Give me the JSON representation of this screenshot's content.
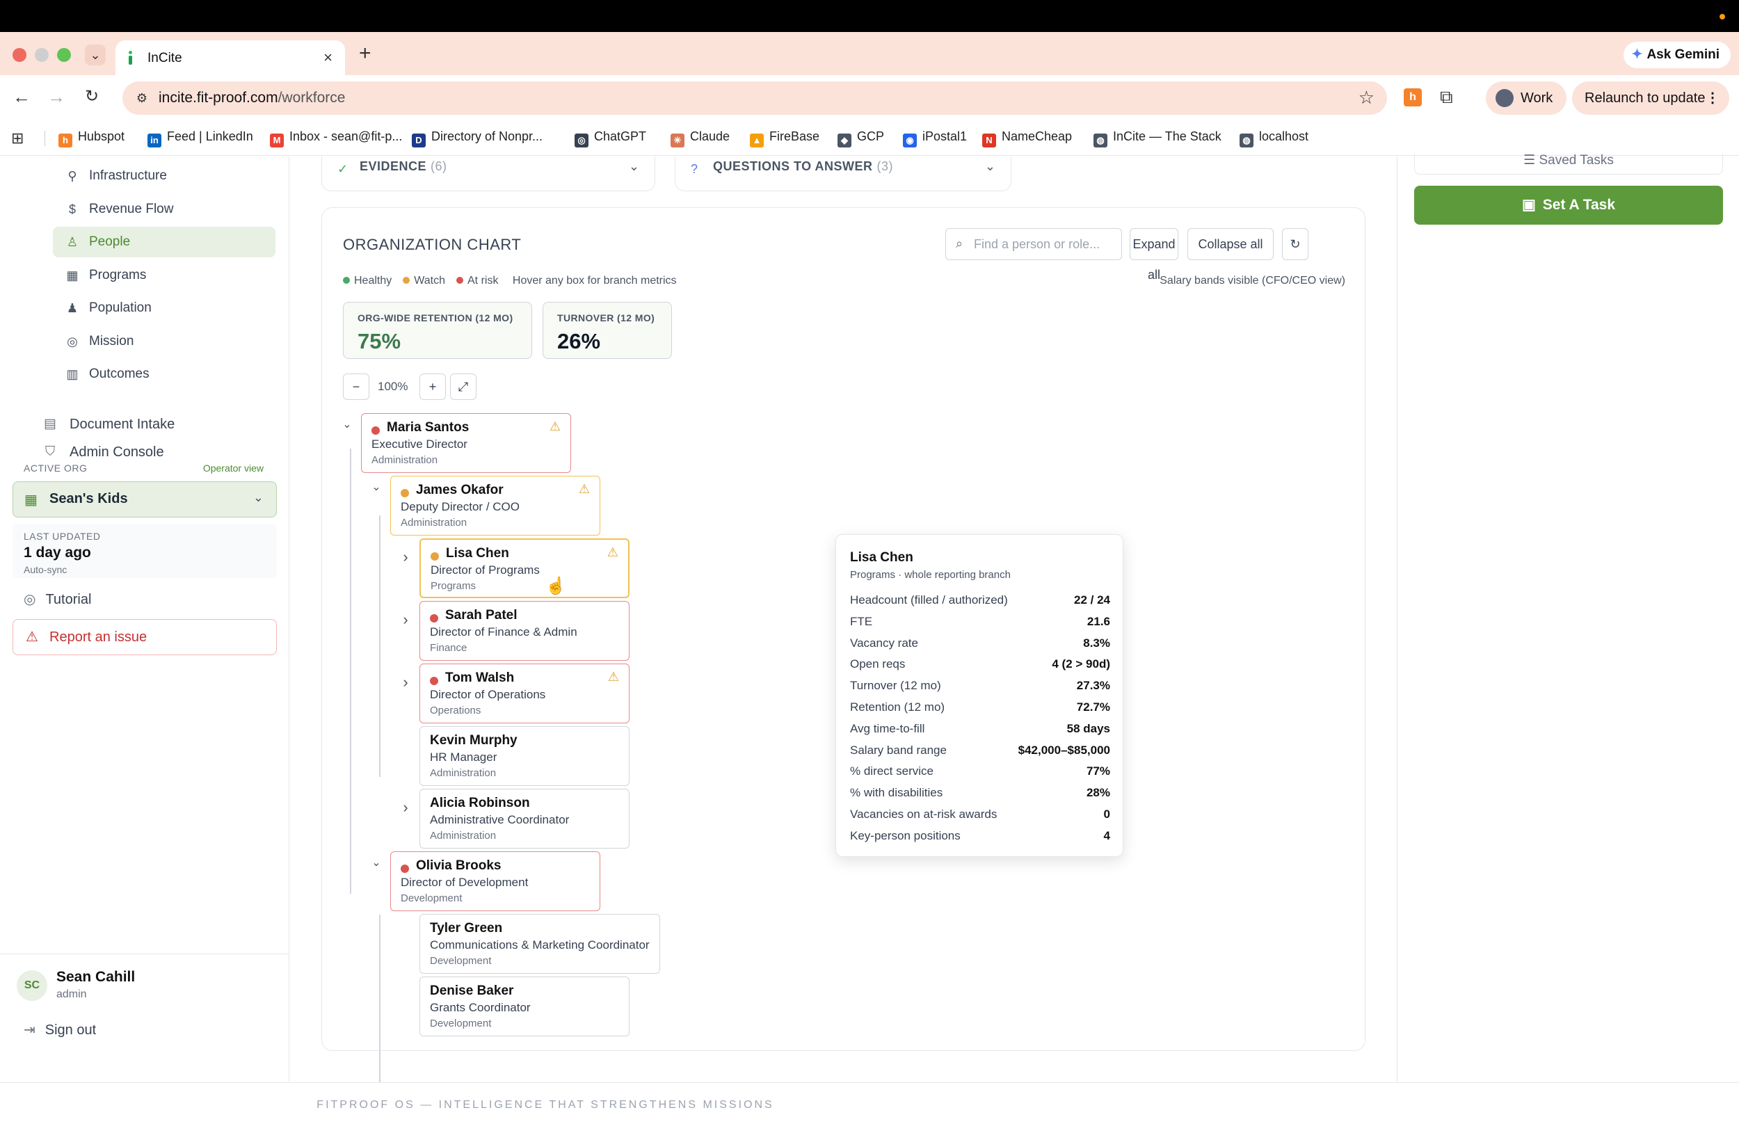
{
  "browser": {
    "tab_title": "InCite",
    "url_host": "incite.fit-proof.com",
    "url_path": "/workforce",
    "ask_gemini": "Ask Gemini",
    "profile": "Work",
    "relaunch": "Relaunch to update",
    "bookmarks": [
      {
        "label": "Hubspot",
        "icon": "hubspot-icon",
        "color": "#f5822a"
      },
      {
        "label": "Feed | LinkedIn",
        "icon": "linkedin-icon",
        "color": "#0a66c2"
      },
      {
        "label": "Inbox - sean@fit-p...",
        "icon": "gmail-icon",
        "color": "#ea4335"
      },
      {
        "label": "Directory of Nonpr...",
        "icon": "directory-icon",
        "color": "#1e3a8a"
      },
      {
        "label": "ChatGPT",
        "icon": "chatgpt-icon",
        "color": "#374151"
      },
      {
        "label": "Claude",
        "icon": "claude-icon",
        "color": "#d97757"
      },
      {
        "label": "FireBase",
        "icon": "firebase-icon",
        "color": "#f59e0b"
      },
      {
        "label": "GCP",
        "icon": "gcp-icon",
        "color": "#4b5563"
      },
      {
        "label": "iPostal1",
        "icon": "ipostal-icon",
        "color": "#2563eb"
      },
      {
        "label": "NameCheap",
        "icon": "namecheap-icon",
        "color": "#de3723"
      },
      {
        "label": "InCite — The Stack",
        "icon": "globe-icon",
        "color": "#4b5563"
      },
      {
        "label": "localhost",
        "icon": "globe-icon",
        "color": "#4b5563"
      }
    ]
  },
  "sidebar": {
    "sub_items": [
      {
        "label": "Infrastructure",
        "icon": "infrastructure-icon"
      },
      {
        "label": "Revenue Flow",
        "icon": "dollar-icon"
      },
      {
        "label": "People",
        "icon": "person-icon",
        "active": true
      },
      {
        "label": "Programs",
        "icon": "grid-icon"
      },
      {
        "label": "Population",
        "icon": "users-icon"
      },
      {
        "label": "Mission",
        "icon": "target-icon"
      },
      {
        "label": "Outcomes",
        "icon": "bar-chart-icon"
      }
    ],
    "document_intake": "Document Intake",
    "admin_console": "Admin Console",
    "active_org_label": "ACTIVE ORG",
    "operator_view": "Operator view",
    "org_name": "Sean's Kids",
    "last_updated_label": "LAST UPDATED",
    "last_updated_value": "1 day ago",
    "auto_sync": "Auto-sync",
    "tutorial": "Tutorial",
    "report_issue": "Report an issue",
    "user_initials": "SC",
    "user_name": "Sean Cahill",
    "user_role": "admin",
    "sign_out": "Sign out"
  },
  "main": {
    "evidence_label": "EVIDENCE",
    "evidence_count": "(6)",
    "questions_label": "QUESTIONS TO ANSWER",
    "questions_count": "(3)",
    "org_chart_title": "ORGANIZATION CHART",
    "search_placeholder": "Find a person or role...",
    "expand_all": "Expand all",
    "collapse_all": "Collapse all",
    "legend": [
      {
        "label": "Healthy",
        "color": "#4ca86a"
      },
      {
        "label": "Watch",
        "color": "#e7a33e"
      },
      {
        "label": "At risk",
        "color": "#d9534f"
      }
    ],
    "hover_hint": "Hover any box for branch metrics",
    "salary_note": "Salary bands visible (CFO/CEO view)",
    "metrics": [
      {
        "label": "ORG-WIDE RETENTION (12 MO)",
        "value": "75%",
        "color": "#3d7a4e"
      },
      {
        "label": "TURNOVER (12 MO)",
        "value": "26%",
        "color": "#111827"
      }
    ],
    "zoom": "100%",
    "nodes": [
      {
        "name": "Maria Santos",
        "role": "Executive Director",
        "dept": "Administration",
        "status": "at-risk",
        "warn": true
      },
      {
        "name": "James Okafor",
        "role": "Deputy Director / COO",
        "dept": "Administration",
        "status": "watch",
        "warn": true
      },
      {
        "name": "Lisa Chen",
        "role": "Director of Programs",
        "dept": "Programs",
        "status": "watch",
        "warn": true
      },
      {
        "name": "Sarah Patel",
        "role": "Director of Finance & Admin",
        "dept": "Finance",
        "status": "at-risk",
        "warn": false
      },
      {
        "name": "Tom Walsh",
        "role": "Director of Operations",
        "dept": "Operations",
        "status": "at-risk",
        "warn": true
      },
      {
        "name": "Kevin Murphy",
        "role": "HR Manager",
        "dept": "Administration",
        "status": "none",
        "warn": false
      },
      {
        "name": "Alicia Robinson",
        "role": "Administrative Coordinator",
        "dept": "Administration",
        "status": "none",
        "warn": false
      },
      {
        "name": "Olivia Brooks",
        "role": "Director of Development",
        "dept": "Development",
        "status": "at-risk",
        "warn": false
      },
      {
        "name": "Tyler Green",
        "role": "Communications & Marketing Coordinator",
        "dept": "Development",
        "status": "none",
        "warn": false
      },
      {
        "name": "Denise Baker",
        "role": "Grants Coordinator",
        "dept": "Development",
        "status": "none",
        "warn": false
      }
    ],
    "tooltip": {
      "name": "Lisa Chen",
      "subtitle": "Programs · whole reporting branch",
      "rows": [
        {
          "k": "Headcount (filled / authorized)",
          "v": "22 / 24"
        },
        {
          "k": "FTE",
          "v": "21.6"
        },
        {
          "k": "Vacancy rate",
          "v": "8.3%"
        },
        {
          "k": "Open reqs",
          "v": "4 (2 > 90d)"
        },
        {
          "k": "Turnover (12 mo)",
          "v": "27.3%"
        },
        {
          "k": "Retention (12 mo)",
          "v": "72.7%"
        },
        {
          "k": "Avg time-to-fill",
          "v": "58 days"
        },
        {
          "k": "Salary band range",
          "v": "$42,000–$85,000"
        },
        {
          "k": "% direct service",
          "v": "77%"
        },
        {
          "k": "% with disabilities",
          "v": "28%"
        },
        {
          "k": "Vacancies on at-risk awards",
          "v": "0"
        },
        {
          "k": "Key-person positions",
          "v": "4"
        }
      ]
    }
  },
  "right_panel": {
    "saved_tasks": "Saved Tasks",
    "set_a_task": "Set A Task"
  },
  "footer": "FITPROOF OS — INTELLIGENCE THAT STRENGTHENS MISSIONS"
}
